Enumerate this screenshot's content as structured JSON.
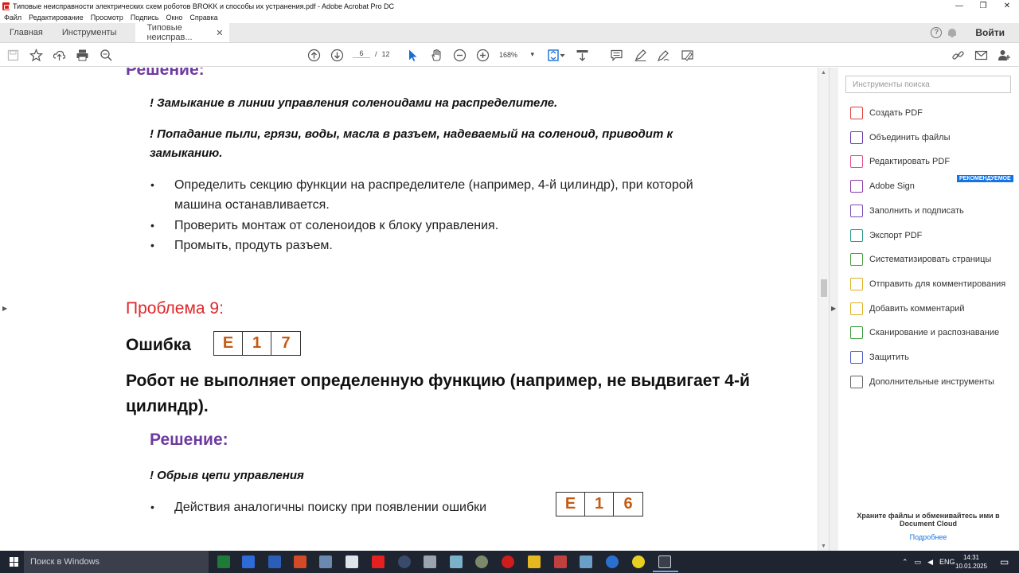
{
  "window": {
    "title": "Типовые неисправности электрических схем роботов BROKK и способы их устранения.pdf - Adobe Acrobat Pro DC",
    "controls": [
      "—",
      "❐",
      "✕"
    ]
  },
  "menu": [
    "Файл",
    "Редактирование",
    "Просмотр",
    "Подпись",
    "Окно",
    "Справка"
  ],
  "tabs": {
    "home": "Главная",
    "tools": "Инструменты",
    "document": "Типовые неисправ...",
    "close": "✕",
    "help": "?",
    "signin": "Войти"
  },
  "toolbar": {
    "page_current": "6",
    "page_sep": "/",
    "page_total": "12",
    "zoom": "168%",
    "zoom_arrow": "▾"
  },
  "document": {
    "solution1_heading": "Решение:",
    "cause1": "! Замыкание в линии управления соленоидами на распределителе.",
    "cause2_line1": "! Попадание пыли, грязи, воды, масла в разъем, надеваемый на соленоид, приводит к",
    "cause2_line2": "замыканию.",
    "bullet_symbol": "•",
    "bullets1": [
      "Определить секцию функции на распределителе (например, 4-й цилиндр), при которой",
      "машина останавливается.",
      "Проверить монтаж от соленоидов к блоку управления.",
      "Промыть, продуть разъем."
    ],
    "problem_heading": "Проблема 9:",
    "error_label": "Ошибка",
    "error_code": [
      "E",
      "1",
      "7"
    ],
    "problem_line1": "Робот не выполняет определенную функцию (например, не выдвигает 4-й",
    "problem_line2": "цилиндр).",
    "solution2_heading": "Решение:",
    "cause3": "! Обрыв цепи управления",
    "bullet_last": "Действия аналогичны поиску при появлении ошибки",
    "ref_code": [
      "E",
      "1",
      "6"
    ]
  },
  "right_panel": {
    "search_placeholder": "Инструменты поиска",
    "tools": [
      {
        "label": "Создать PDF",
        "color": "#e0403a"
      },
      {
        "label": "Объединить файлы",
        "color": "#6a3aa8"
      },
      {
        "label": "Редактировать PDF",
        "color": "#e04f8a"
      },
      {
        "label": "Adobe Sign",
        "color": "#8a3aa8"
      },
      {
        "label": "Заполнить и подписать",
        "color": "#7a4ab8"
      },
      {
        "label": "Экспорт PDF",
        "color": "#2a9a8a"
      },
      {
        "label": "Систематизировать страницы",
        "color": "#4aa040"
      },
      {
        "label": "Отправить для комментирования",
        "color": "#e0b020"
      },
      {
        "label": "Добавить комментарий",
        "color": "#e0b020"
      },
      {
        "label": "Сканирование и распознавание",
        "color": "#3a9a3a"
      },
      {
        "label": "Защитить",
        "color": "#4a5ab8"
      },
      {
        "label": "Дополнительные инструменты",
        "color": "#666666"
      }
    ],
    "recommended_badge": "РЕКОМЕНДУЕМОЕ",
    "cloud_line1": "Храните файлы и обменивайтесь ими в",
    "cloud_line2": "Document Cloud",
    "cloud_link": "Подробнее"
  },
  "taskbar": {
    "search_placeholder": "Поиск в Windows",
    "lang": "ENG",
    "time": "14:31",
    "date": "10.01.2025"
  }
}
